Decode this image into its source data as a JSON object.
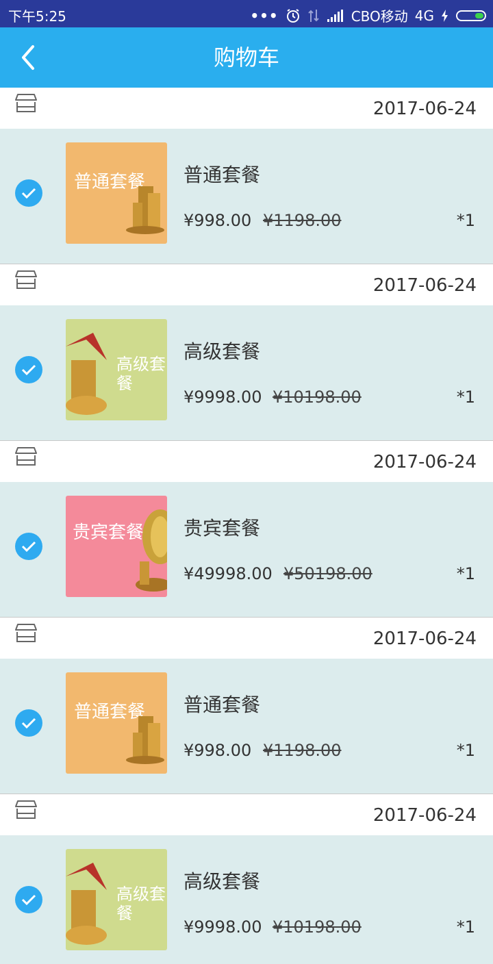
{
  "status_bar": {
    "time": "下午5:25",
    "dots": "•••",
    "carrier": "CBO移动",
    "network": "4G"
  },
  "header": {
    "title": "购物车"
  },
  "colors": {
    "accent": "#2aaeee",
    "status_bar": "#2a3a9a",
    "check": "#2eaaf0",
    "item_bg": "#dceced"
  },
  "items": [
    {
      "date": "2017-06-24",
      "name": "普通套餐",
      "price": "¥998.00",
      "original_price": "¥1198.00",
      "qty": "*1",
      "thumb_text": "普通套餐",
      "thumb_color": "#f2b86e",
      "checked": true
    },
    {
      "date": "2017-06-24",
      "name": "高级套餐",
      "price": "¥9998.00",
      "original_price": "¥10198.00",
      "qty": "*1",
      "thumb_text": "高级套餐",
      "thumb_color": "#cfdb8e",
      "checked": true
    },
    {
      "date": "2017-06-24",
      "name": "贵宾套餐",
      "price": "¥49998.00",
      "original_price": "¥50198.00",
      "qty": "*1",
      "thumb_text": "贵宾套餐",
      "thumb_color": "#f48a9a",
      "checked": true
    },
    {
      "date": "2017-06-24",
      "name": "普通套餐",
      "price": "¥998.00",
      "original_price": "¥1198.00",
      "qty": "*1",
      "thumb_text": "普通套餐",
      "thumb_color": "#f2b86e",
      "checked": true
    },
    {
      "date": "2017-06-24",
      "name": "高级套餐",
      "price": "¥9998.00",
      "original_price": "¥10198.00",
      "qty": "*1",
      "thumb_text": "高级套餐",
      "thumb_color": "#cfdb8e",
      "checked": true
    }
  ]
}
